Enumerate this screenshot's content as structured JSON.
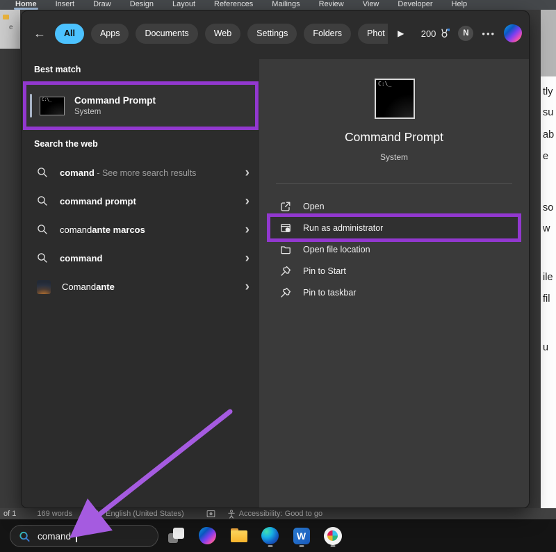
{
  "app": {
    "ribbon_tabs": [
      "Home",
      "Insert",
      "Draw",
      "Design",
      "Layout",
      "References",
      "Mailings",
      "Review",
      "View",
      "Developer",
      "Help"
    ],
    "active_tab": "Home"
  },
  "overlay": {
    "filters": [
      {
        "label": "All",
        "active": true,
        "clipped": false
      },
      {
        "label": "Apps",
        "active": false,
        "clipped": false
      },
      {
        "label": "Documents",
        "active": false,
        "clipped": false
      },
      {
        "label": "Web",
        "active": false,
        "clipped": false
      },
      {
        "label": "Settings",
        "active": false,
        "clipped": false
      },
      {
        "label": "Folders",
        "active": false,
        "clipped": false
      },
      {
        "label": "Phot",
        "active": false,
        "clipped": true
      }
    ],
    "rewards_points": "200",
    "account_initial": "N",
    "best_match": {
      "label": "Best match",
      "item": {
        "title": "Command Prompt",
        "subtitle": "System"
      }
    },
    "web": {
      "label": "Search the web",
      "items": [
        {
          "prefix": "",
          "bold": "comand",
          "suffix": " - See more search results",
          "icon": "search-icon"
        },
        {
          "prefix": "",
          "bold": "command prompt",
          "suffix": "",
          "icon": "search-icon"
        },
        {
          "prefix": "comand",
          "bold": "ante marcos",
          "suffix": "",
          "icon": "search-icon"
        },
        {
          "prefix": "",
          "bold": "command",
          "suffix": "",
          "icon": "search-icon"
        },
        {
          "prefix": "Comand",
          "bold": "ante",
          "suffix": "",
          "icon": "thumbnail"
        }
      ]
    },
    "preview": {
      "title": "Command Prompt",
      "subtitle": "System",
      "actions": [
        {
          "label": "Open",
          "icon": "open-icon",
          "highlighted": false
        },
        {
          "label": "Run as administrator",
          "icon": "run-admin-icon",
          "highlighted": true
        },
        {
          "label": "Open file location",
          "icon": "folder-icon",
          "highlighted": false
        },
        {
          "label": "Pin to Start",
          "icon": "pin-icon",
          "highlighted": false
        },
        {
          "label": "Pin to taskbar",
          "icon": "pin-icon",
          "highlighted": false
        }
      ]
    }
  },
  "status_bar": {
    "page": "of 1",
    "words": "169 words",
    "language": "English (United States)",
    "accessibility": "Accessibility: Good to go"
  },
  "taskbar": {
    "search_value": "comand",
    "icons": [
      {
        "name": "task-view",
        "running": false
      },
      {
        "name": "copilot",
        "running": false
      },
      {
        "name": "file-explorer",
        "running": false
      },
      {
        "name": "edge",
        "running": true
      },
      {
        "name": "word",
        "running": true
      },
      {
        "name": "slack",
        "running": true
      }
    ]
  },
  "document_edge_fragments": [
    "tly",
    "su",
    "ab",
    "e",
    "so",
    "w",
    "ile",
    "fil",
    "u"
  ],
  "colors": {
    "accent_blue": "#4cc2ff",
    "highlight_purple": "#9238cf",
    "arrow_purple": "#a55be0"
  }
}
